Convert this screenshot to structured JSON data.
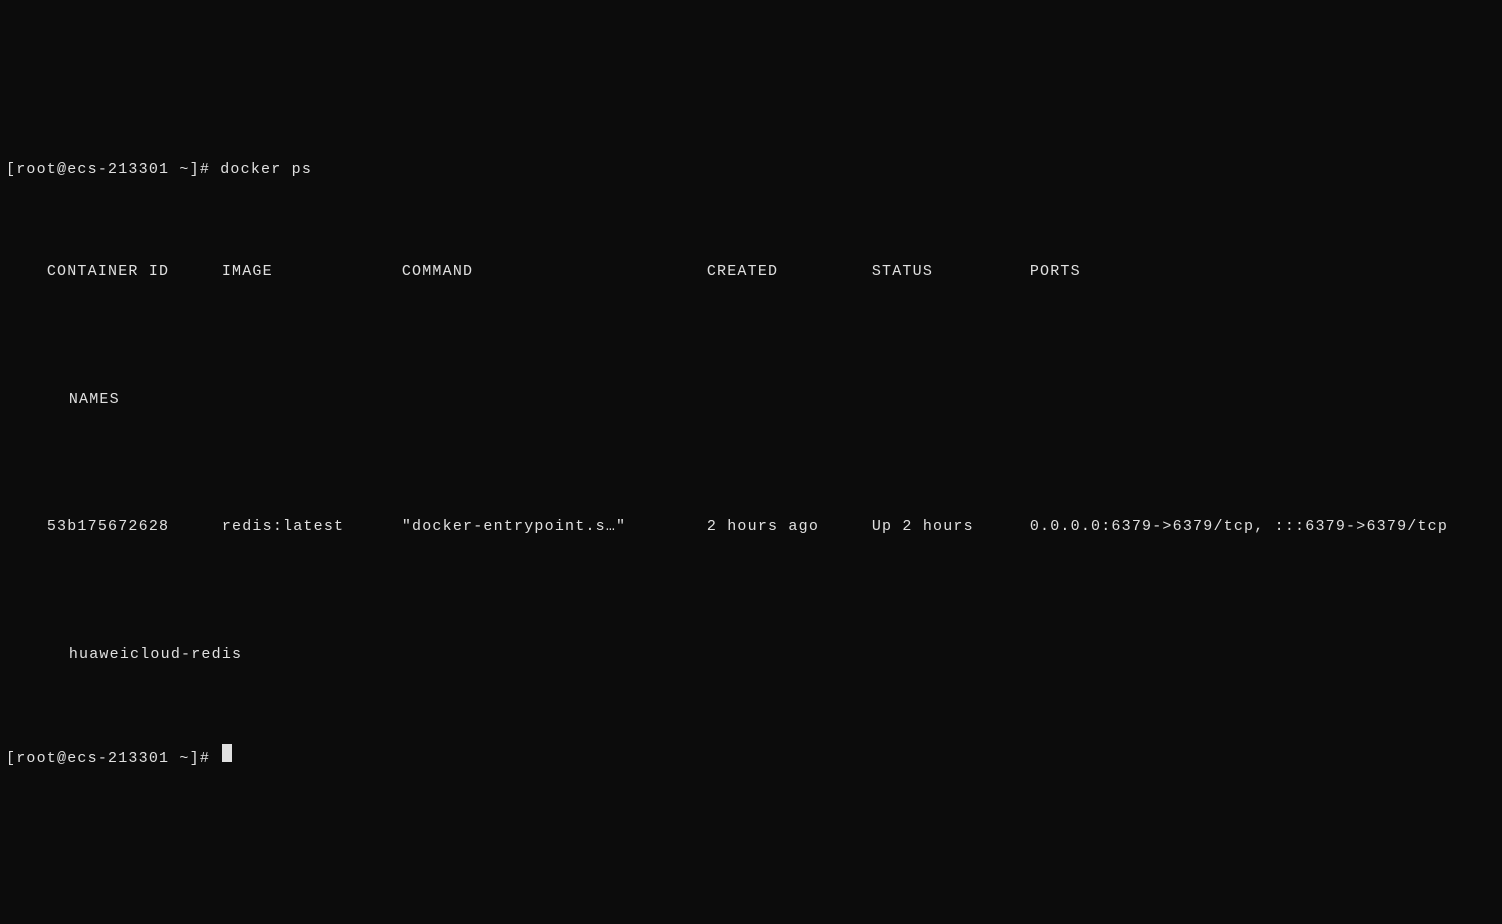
{
  "prompts": {
    "line1": "[root@ecs-213301 ~]# ",
    "command1": "docker ps",
    "line2": "[root@ecs-213301 ~]# "
  },
  "headers": {
    "container_id": "CONTAINER ID",
    "image": "IMAGE",
    "command": "COMMAND",
    "created": "CREATED",
    "status": "STATUS",
    "ports": "PORTS",
    "names": "NAMES"
  },
  "rows": [
    {
      "container_id": "53b175672628",
      "image": "redis:latest",
      "command": "\"docker-entrypoint.s…\"",
      "created": "2 hours ago",
      "status": "Up 2 hours",
      "ports": "0.0.0.0:6379->6379/tcp, :::6379->6379/tcp",
      "names": "huaweicloud-redis"
    }
  ]
}
